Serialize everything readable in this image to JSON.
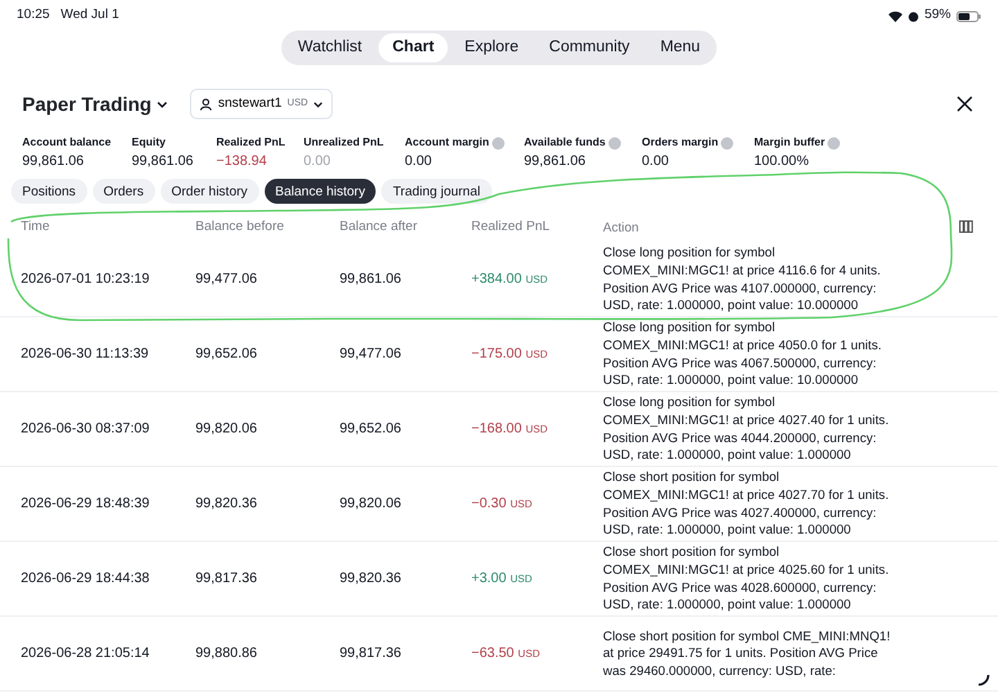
{
  "status_bar": {
    "time": "10:25",
    "date": "Wed Jul 1",
    "battery": "59%"
  },
  "nav": [
    {
      "label": "Watchlist",
      "selected": false
    },
    {
      "label": "Chart",
      "selected": true
    },
    {
      "label": "Explore",
      "selected": false
    },
    {
      "label": "Community",
      "selected": false
    },
    {
      "label": "Menu",
      "selected": false
    }
  ],
  "panel": {
    "title": "Paper Trading",
    "account": "snstewart1",
    "currency": "USD"
  },
  "stats": [
    {
      "label": "Account balance",
      "value": "99,861.06",
      "color": "#131722",
      "info": false
    },
    {
      "label": "Equity",
      "value": "99,861.06",
      "color": "#131722",
      "info": false
    },
    {
      "label": "Realized PnL",
      "value": "−138.94",
      "color": "#b2404a",
      "info": false
    },
    {
      "label": "Unrealized PnL",
      "value": "0.00",
      "color": "#a0a3ab",
      "info": false
    },
    {
      "label": "Account margin",
      "value": "0.00",
      "color": "#131722",
      "info": true
    },
    {
      "label": "Available funds",
      "value": "99,861.06",
      "color": "#131722",
      "info": true
    },
    {
      "label": "Orders margin",
      "value": "0.00",
      "color": "#131722",
      "info": true
    },
    {
      "label": "Margin buffer",
      "value": "100.00%",
      "color": "#131722",
      "info": true
    }
  ],
  "tabs": [
    {
      "label": "Positions",
      "selected": false
    },
    {
      "label": "Orders",
      "selected": false
    },
    {
      "label": "Order history",
      "selected": false
    },
    {
      "label": "Balance history",
      "selected": true
    },
    {
      "label": "Trading journal",
      "selected": false
    }
  ],
  "table": {
    "columns": [
      "Time",
      "Balance before",
      "Balance after",
      "Realized PnL",
      "Action"
    ],
    "rows": [
      {
        "time": "2026-07-01 10:23:19",
        "before": "99,477.06",
        "after": "99,861.06",
        "pnl": "+384.00",
        "currency": "USD",
        "positive": true,
        "action": "Close long position for symbol\nCOMEX_MINI:MGC1! at price 4116.6 for 4 units.\nPosition AVG Price was 4107.000000, currency:\nUSD, rate: 1.000000, point value: 10.000000"
      },
      {
        "time": "2026-06-30 11:13:39",
        "before": "99,652.06",
        "after": "99,477.06",
        "pnl": "−175.00",
        "currency": "USD",
        "positive": false,
        "action": "Close long position for symbol\nCOMEX_MINI:MGC1! at price 4050.0 for 1 units.\nPosition AVG Price was 4067.500000, currency:\nUSD, rate: 1.000000, point value: 10.000000"
      },
      {
        "time": "2026-06-30 08:37:09",
        "before": "99,820.06",
        "after": "99,652.06",
        "pnl": "−168.00",
        "currency": "USD",
        "positive": false,
        "action": "Close long position for symbol\nCOMEX_MINI:MGC1! at price 4027.40 for 1 units.\nPosition AVG Price was 4044.200000, currency:\nUSD, rate: 1.000000, point value: 1.000000"
      },
      {
        "time": "2026-06-29 18:48:39",
        "before": "99,820.36",
        "after": "99,820.06",
        "pnl": "−0.30",
        "currency": "USD",
        "positive": false,
        "action": "Close short position for symbol\nCOMEX_MINI:MGC1! at price 4027.70 for 1 units.\nPosition AVG Price was 4027.400000, currency:\nUSD, rate: 1.000000, point value: 1.000000"
      },
      {
        "time": "2026-06-29 18:44:38",
        "before": "99,817.36",
        "after": "99,820.36",
        "pnl": "+3.00",
        "currency": "USD",
        "positive": true,
        "action": "Close short position for symbol\nCOMEX_MINI:MGC1! at price 4025.60 for 1 units.\nPosition AVG Price was 4028.600000, currency:\nUSD, rate: 1.000000, point value: 1.000000"
      },
      {
        "time": "2026-06-28 21:05:14",
        "before": "99,880.86",
        "after": "99,817.36",
        "pnl": "−63.50",
        "currency": "USD",
        "positive": false,
        "action": "Close short position for symbol CME_MINI:MNQ1!\nat price 29491.75 for 1 units. Position AVG Price\nwas 29460.000000, currency: USD, rate:"
      }
    ]
  },
  "loading": true
}
